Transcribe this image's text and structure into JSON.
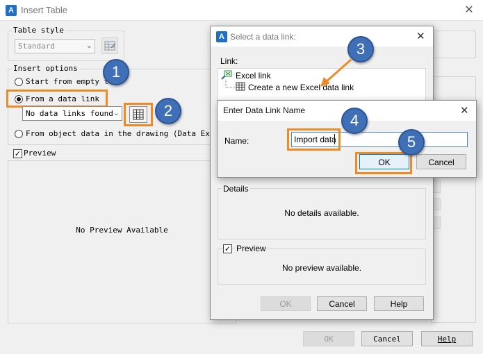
{
  "main_window": {
    "title": "Insert Table",
    "close_glyph": "✕",
    "table_style": {
      "label": "Table style",
      "value": "Standard"
    },
    "insert_options": {
      "label": "Insert options",
      "option_empty": "Start from empty table",
      "option_data_link": "From a data link",
      "data_link_value": "No data links found",
      "option_object_data": "From object data in the drawing (Data Extraction)"
    },
    "preview": {
      "label": "Preview",
      "checked": true,
      "empty_text": "No Preview Available"
    },
    "buttons": {
      "ok": "OK",
      "cancel": "Cancel",
      "help": "Help"
    }
  },
  "select_data_link_dialog": {
    "title": "Select a data link:",
    "close_glyph": "✕",
    "link_label": "Link:",
    "tree": {
      "root": "Excel link",
      "child": "Create a new Excel data link"
    },
    "details": {
      "label": "Details",
      "text": "No details available."
    },
    "preview": {
      "label": "Preview",
      "checked": true,
      "text": "No preview available."
    },
    "buttons": {
      "ok": "OK",
      "cancel": "Cancel",
      "help": "Help"
    }
  },
  "enter_name_dialog": {
    "title": "Enter Data Link Name",
    "close_glyph": "✕",
    "name_label": "Name:",
    "name_value": "Import data",
    "buttons": {
      "ok": "OK",
      "cancel": "Cancel"
    }
  },
  "callouts": [
    "1",
    "2",
    "3",
    "4",
    "5"
  ],
  "colors": {
    "callout_circle": "#3f6fb6",
    "highlight_border": "#f08a24",
    "app_icon": "#1f6fc5"
  }
}
